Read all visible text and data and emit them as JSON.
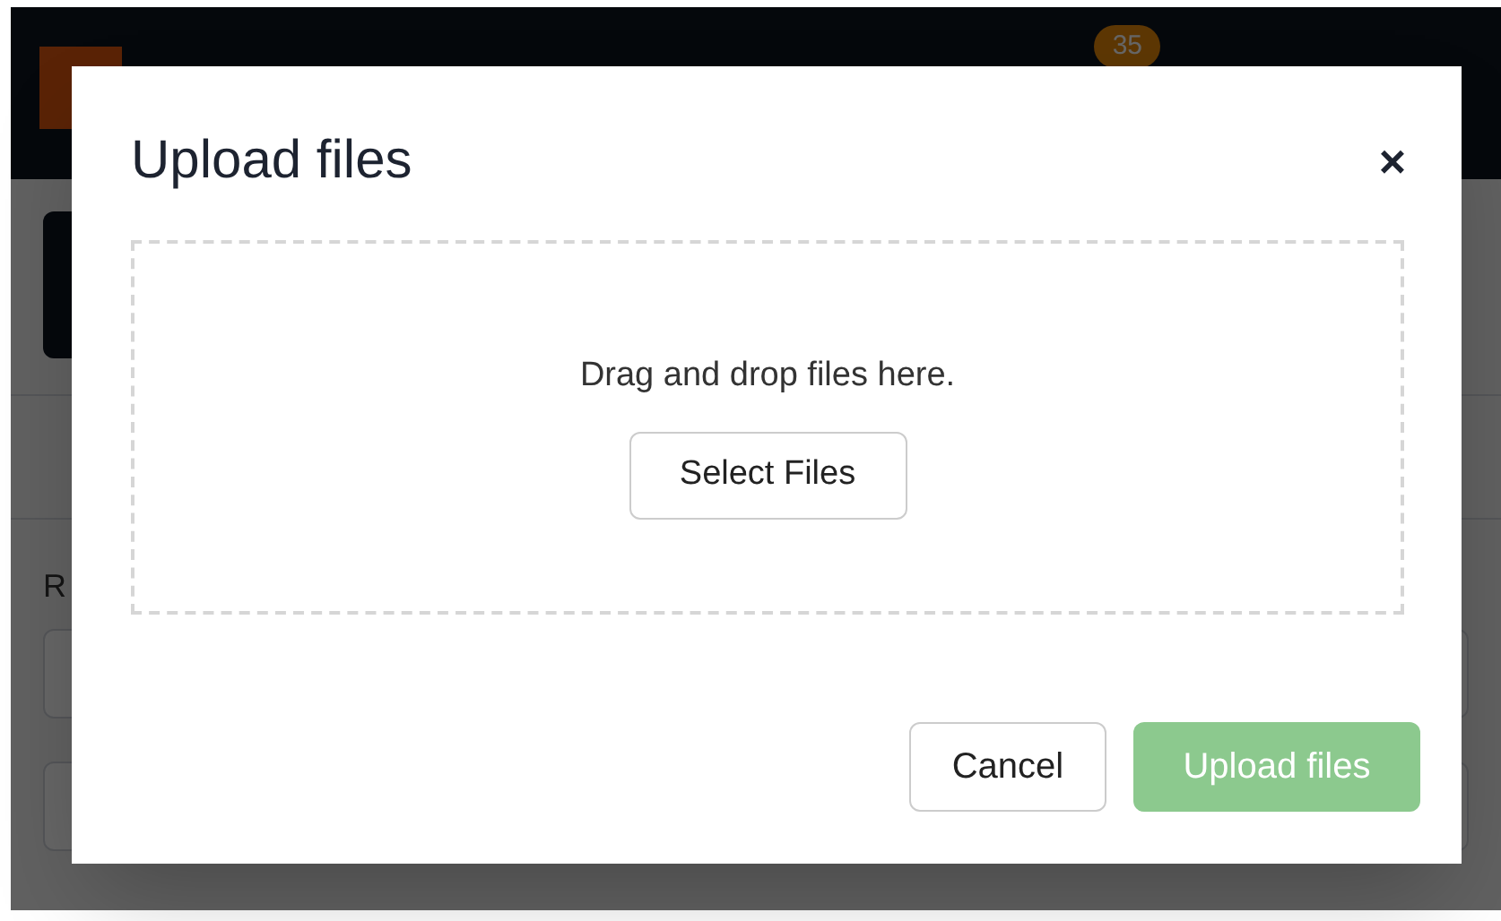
{
  "background": {
    "notification_count": "35",
    "field_label": "R"
  },
  "dialog": {
    "title": "Upload files",
    "close": "×",
    "dropzone": {
      "hint": "Drag and drop files here.",
      "button": "Select Files"
    },
    "buttons": [
      {
        "label": "Cancel",
        "kind": "secondary",
        "disabled": false
      },
      {
        "label": "Upload files",
        "kind": "primary",
        "disabled": true
      }
    ]
  }
}
